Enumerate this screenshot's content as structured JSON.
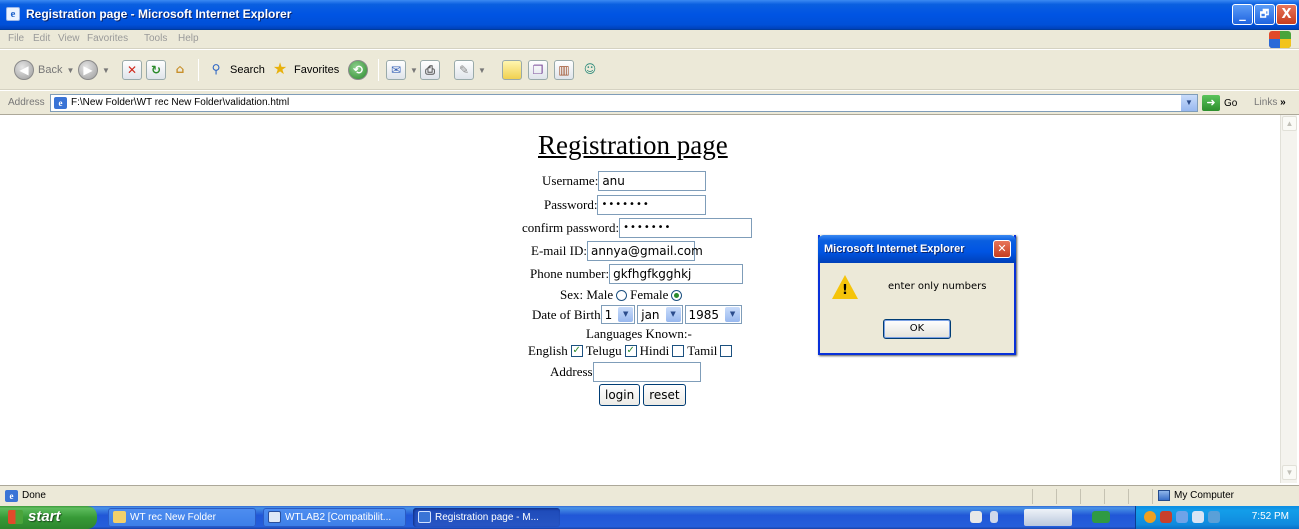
{
  "window": {
    "title": "Registration page - Microsoft Internet Explorer",
    "minimize": "_",
    "maximize": "🗗",
    "close": "X"
  },
  "menu": [
    "File",
    "Edit",
    "View",
    "Favorites",
    "Tools",
    "Help"
  ],
  "toolbar": {
    "back_label": "Back",
    "search_label": "Search",
    "favorites_label": "Favorites"
  },
  "address": {
    "label": "Address",
    "url": "F:\\New Folder\\WT rec New Folder\\validation.html",
    "go_label": "Go",
    "links_label": "Links",
    "links_chevron": "»"
  },
  "form": {
    "heading": "Registration page",
    "username_label": "Username:",
    "username_value": "anu",
    "password_label": "Password:",
    "password_value": "•••••••",
    "confirm_label": "confirm password:",
    "confirm_value": "•••••••",
    "email_label": "E-mail ID:",
    "email_value": "annya@gmail.com",
    "phone_label": "Phone number:",
    "phone_value": "gkfhgfkgghkj",
    "sex_label": "Sex:",
    "sex_male": "Male",
    "sex_female": "Female",
    "sex_selected": "Female",
    "dob_label": "Date of Birth",
    "dob_day": "1",
    "dob_month": "jan",
    "dob_year": "1985",
    "languages_label": "Languages Known:-",
    "languages": [
      {
        "name": "English",
        "checked": true
      },
      {
        "name": "Telugu",
        "checked": true
      },
      {
        "name": "Hindi",
        "checked": false
      },
      {
        "name": "Tamil",
        "checked": false
      }
    ],
    "address_label": "Address",
    "address_value": "",
    "login_button": "login",
    "reset_button": "reset"
  },
  "dialog": {
    "title": "Microsoft Internet Explorer",
    "message": "enter only numbers",
    "ok_label": "OK"
  },
  "status": {
    "text": "Done",
    "zone": "My Computer"
  },
  "taskbar": {
    "start_label": "start",
    "tasks": [
      {
        "label": "WT rec New Folder",
        "active": false
      },
      {
        "label": "WTLAB2 [Compatibilit...",
        "active": false
      },
      {
        "label": "Registration page - M...",
        "active": true
      }
    ],
    "clock": "7:52 PM"
  },
  "colors": {
    "titlebar": "#0054e3",
    "chrome": "#ece9d8",
    "taskbar": "#245edb",
    "start_button": "#379a37"
  }
}
